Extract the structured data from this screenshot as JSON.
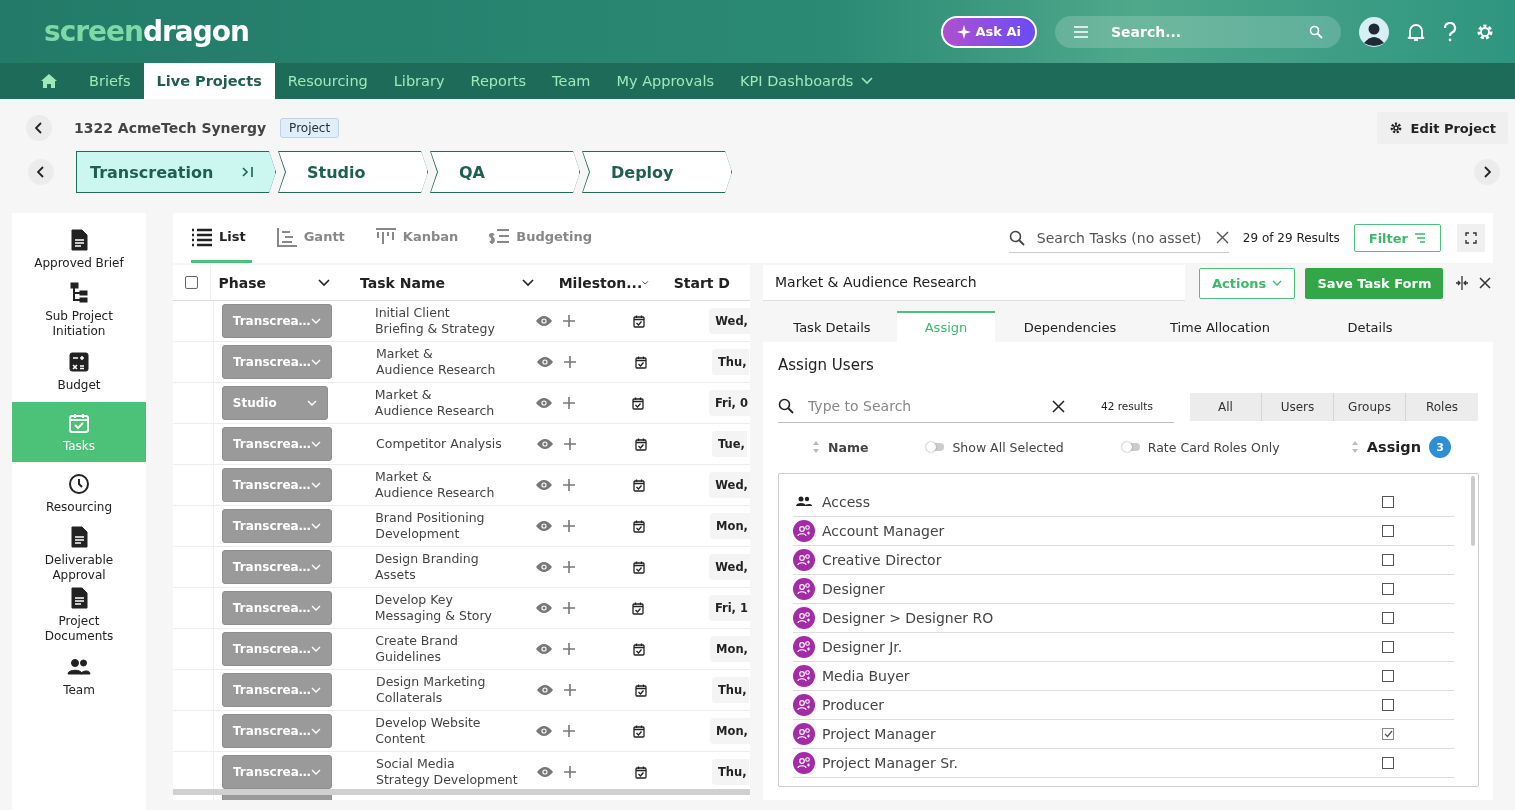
{
  "header": {
    "logo_light": "screen",
    "logo_bold": "dragon",
    "ask_ai": "Ask Ai",
    "search_placeholder": "Search..."
  },
  "nav": [
    {
      "label": "Briefs",
      "selected": false,
      "dropdown": false
    },
    {
      "label": "Live Projects",
      "selected": true,
      "dropdown": false
    },
    {
      "label": "Resourcing",
      "selected": false,
      "dropdown": false
    },
    {
      "label": "Library",
      "selected": false,
      "dropdown": false
    },
    {
      "label": "Reports",
      "selected": false,
      "dropdown": false
    },
    {
      "label": "Team",
      "selected": false,
      "dropdown": false
    },
    {
      "label": "My Approvals",
      "selected": false,
      "dropdown": false
    },
    {
      "label": "KPI Dashboards",
      "selected": false,
      "dropdown": true
    }
  ],
  "project": {
    "title": "1322 AcmeTech Synergy",
    "badge": "Project",
    "edit_button": "Edit Project"
  },
  "stages": [
    {
      "label": "Transcreation",
      "selected": true
    },
    {
      "label": "Studio",
      "selected": false
    },
    {
      "label": "QA",
      "selected": false
    },
    {
      "label": "Deploy",
      "selected": false
    }
  ],
  "sidebar": [
    {
      "label": "Approved Brief",
      "kind": "document",
      "selected": false
    },
    {
      "label": "Sub Project Initiation",
      "kind": "hierarchy",
      "selected": false
    },
    {
      "label": "Budget",
      "kind": "calculator",
      "selected": false
    },
    {
      "label": "Tasks",
      "kind": "calendar",
      "selected": true
    },
    {
      "label": "Resourcing",
      "kind": "clock",
      "selected": false
    },
    {
      "label": "Deliverable Approval",
      "kind": "document",
      "selected": false
    },
    {
      "label": "Project Documents",
      "kind": "document",
      "selected": false
    },
    {
      "label": "Team",
      "kind": "people",
      "selected": false
    }
  ],
  "views": [
    {
      "label": "List",
      "kind": "list",
      "selected": true
    },
    {
      "label": "Gantt",
      "kind": "gantt",
      "selected": false
    },
    {
      "label": "Kanban",
      "kind": "kanban",
      "selected": false
    },
    {
      "label": "Budgeting",
      "kind": "budget",
      "selected": false
    }
  ],
  "task_search": {
    "placeholder": "Search Tasks (no asset)",
    "results": "29 of 29 Results",
    "filter_button": "Filter"
  },
  "table": {
    "select_all": false,
    "columns": [
      "Phase",
      "Task Name",
      "Mileston...",
      "Start D"
    ],
    "rows": [
      {
        "phase": "Transcrea…",
        "task": "Initial Client\nBriefing & Strategy",
        "start": "Wed,"
      },
      {
        "phase": "Transcrea…",
        "task": "Market &\nAudience Research",
        "start": "Thu,"
      },
      {
        "phase": "Studio",
        "task": "Market &\nAudience Research",
        "start": "Fri, 0"
      },
      {
        "phase": "Transcrea…",
        "task": "Competitor Analysis",
        "start": "Tue,"
      },
      {
        "phase": "Transcrea…",
        "task": "Market &\nAudience Research",
        "start": "Wed,"
      },
      {
        "phase": "Transcrea…",
        "task": "Brand Positioning\nDevelopment",
        "start": "Mon,"
      },
      {
        "phase": "Transcrea…",
        "task": "Design Branding\nAssets",
        "start": "Wed,"
      },
      {
        "phase": "Transcrea…",
        "task": "Develop Key\nMessaging & Story",
        "start": "Fri, 1"
      },
      {
        "phase": "Transcrea…",
        "task": "Create Brand\nGuidelines",
        "start": "Mon,"
      },
      {
        "phase": "Transcrea…",
        "task": "Design Marketing\nCollaterals",
        "start": "Thu,"
      },
      {
        "phase": "Transcrea…",
        "task": "Develop Website\nContent",
        "start": "Mon,"
      },
      {
        "phase": "Transcrea…",
        "task": "Social Media\nStrategy Development",
        "start": "Thu,"
      }
    ]
  },
  "task_panel": {
    "title": "Market & Audience Research",
    "actions_button": "Actions",
    "save_button": "Save Task Form",
    "tabs": [
      {
        "label": "Task Details",
        "selected": false
      },
      {
        "label": "Assign",
        "selected": true
      },
      {
        "label": "Dependencies",
        "selected": false
      },
      {
        "label": "Time Allocation",
        "selected": false
      },
      {
        "label": "Details",
        "selected": false
      }
    ],
    "section_title": "Assign Users",
    "search_placeholder": "Type to Search",
    "results": "42 results",
    "filters": [
      "All",
      "Users",
      "Groups",
      "Roles"
    ],
    "name_column": "Name",
    "toggles": [
      {
        "label": "Show All Selected",
        "on": false
      },
      {
        "label": "Rate Card Roles Only",
        "on": false
      }
    ],
    "assign_column": "Assign",
    "assign_count": "3",
    "items": [
      {
        "name": "Access",
        "kind": "group",
        "checked": false
      },
      {
        "name": "Account Manager",
        "kind": "role",
        "checked": false
      },
      {
        "name": "Creative Director",
        "kind": "role",
        "checked": false
      },
      {
        "name": "Designer",
        "kind": "role",
        "checked": false
      },
      {
        "name": "Designer > Designer RO",
        "kind": "role",
        "checked": false
      },
      {
        "name": "Designer Jr.",
        "kind": "role",
        "checked": false
      },
      {
        "name": "Media Buyer",
        "kind": "role",
        "checked": false
      },
      {
        "name": "Producer",
        "kind": "role",
        "checked": false
      },
      {
        "name": "Project Manager",
        "kind": "role",
        "checked": true
      },
      {
        "name": "Project Manager Sr.",
        "kind": "role",
        "checked": false
      }
    ]
  }
}
